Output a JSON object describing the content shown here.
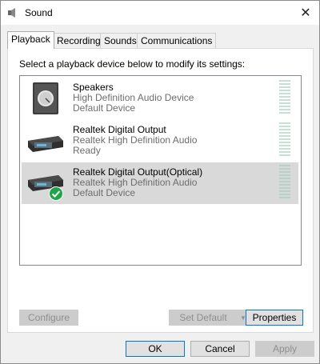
{
  "window": {
    "title": "Sound"
  },
  "tabs": [
    {
      "label": "Playback",
      "active": true
    },
    {
      "label": "Recording",
      "active": false
    },
    {
      "label": "Sounds",
      "active": false
    },
    {
      "label": "Communications",
      "active": false
    }
  ],
  "playback": {
    "instruction": "Select a playback device below to modify its settings:",
    "devices": [
      {
        "name": "Speakers",
        "driver": "High Definition Audio Device",
        "status": "Default Device",
        "icon": "speaker-icon",
        "selected": false
      },
      {
        "name": "Realtek Digital Output",
        "driver": "Realtek High Definition Audio",
        "status": "Ready",
        "icon": "digital-output-icon",
        "selected": false
      },
      {
        "name": "Realtek Digital Output(Optical)",
        "driver": "Realtek High Definition Audio",
        "status": "Default Device",
        "icon": "digital-output-icon",
        "selected": true
      }
    ],
    "configure_label": "Configure",
    "set_default_label": "Set Default",
    "properties_label": "Properties"
  },
  "footer": {
    "ok_label": "OK",
    "cancel_label": "Cancel",
    "apply_label": "Apply"
  },
  "colors": {
    "default_check": "#1fa548",
    "selection": "#d9d9d9",
    "focus_border": "#0078d7",
    "meter": "#c6e0d4"
  }
}
